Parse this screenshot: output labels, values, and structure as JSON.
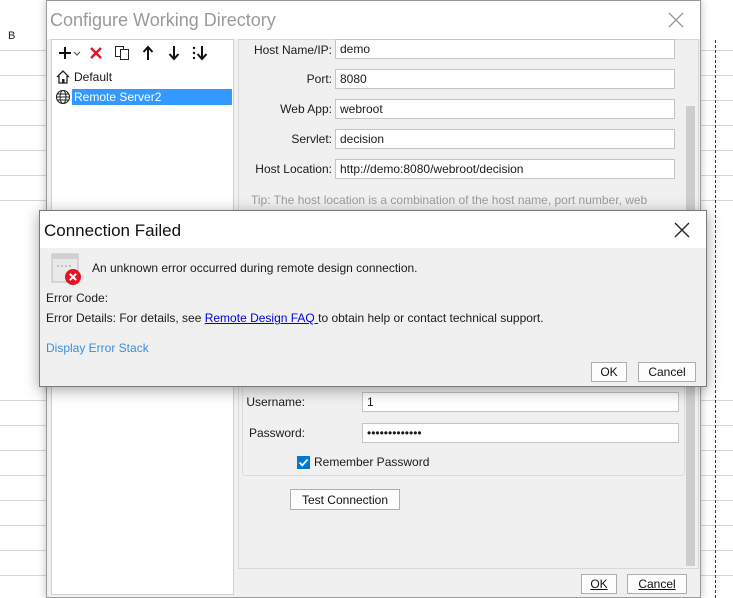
{
  "background": {
    "cell_text": "B"
  },
  "main_dialog": {
    "title": "Configure Working Directory",
    "toolbar": {
      "icons": [
        "add-icon",
        "delete-icon",
        "copy-icon",
        "move-up-icon",
        "move-down-icon",
        "sort-icon"
      ]
    },
    "tree": [
      {
        "label": "Default",
        "icon": "home-icon",
        "selected": false
      },
      {
        "label": "Remote Server2",
        "icon": "globe-icon",
        "selected": true
      }
    ],
    "form": {
      "host_name_label": "Host Name/IP:",
      "host_name_value": "demo",
      "port_label": "Port:",
      "port_value": "8080",
      "web_app_label": "Web App:",
      "web_app_value": "webroot",
      "servlet_label": "Servlet:",
      "servlet_value": "decision",
      "host_location_label": "Host Location:",
      "host_location_value": "http://demo:8080/webroot/decision",
      "tip": "Tip: The host location is a combination of the host name, port number, web",
      "username_label": "Username:",
      "username_value": "1",
      "password_label": "Password:",
      "password_value": "•••••••••••••",
      "remember_label": "Remember Password",
      "remember_checked": true,
      "test_connection_label": "Test Connection"
    },
    "ok_label": "OK",
    "cancel_label": "Cancel"
  },
  "error_dialog": {
    "title": "Connection Failed",
    "message": "An unknown error occurred during remote design connection.",
    "error_code_label": "Error Code:",
    "error_details_prefix": "Error Details: For details, see ",
    "error_details_link": "Remote Design FAQ ",
    "error_details_suffix": "to obtain help or contact technical support.",
    "display_stack_label": "Display Error Stack",
    "ok_label": "OK",
    "cancel_label": "Cancel"
  },
  "colors": {
    "selection": "#3399ff",
    "link": "#0000ee",
    "stack_link": "#3c8fd8",
    "error_red": "#e81123",
    "checkbox": "#0078d7"
  }
}
